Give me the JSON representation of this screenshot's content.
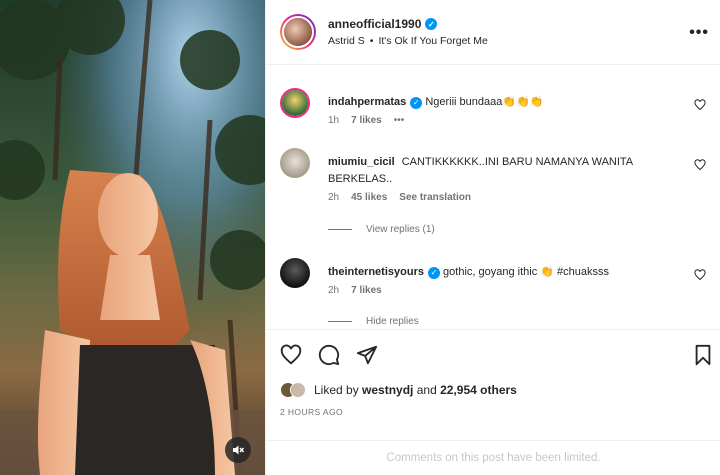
{
  "header": {
    "username": "anneofficial1990",
    "audio_artist": "Astrid S",
    "separator": "•",
    "audio_title": "It's Ok If You Forget Me"
  },
  "comments": [
    {
      "username": "indahpermatas",
      "verified": true,
      "text": "Ngeriii bundaaa👏👏👏",
      "time": "1h",
      "likes": "7 likes",
      "extra": "•••"
    },
    {
      "username": "miumiu_cicil",
      "verified": false,
      "text": "CANTIKKKKKK..INI BARU NAMANYA WANITA BERKELAS..",
      "time": "2h",
      "likes": "45 likes",
      "extra": "See translation",
      "replies": "View replies (1)"
    },
    {
      "username": "theinternetisyours",
      "verified": true,
      "text": "gothic, goyang ithic 👏 #chuaksss",
      "time": "2h",
      "likes": "7 likes",
      "replies": "Hide replies"
    }
  ],
  "post": {
    "liked_prefix": "Liked by",
    "liked_user": "westnydj",
    "liked_and": "and",
    "liked_count": "22,954 others",
    "timestamp": "2 HOURS AGO",
    "comments_limited": "Comments on this post have been limited."
  },
  "icons": {
    "like": "heart-icon",
    "comment": "comment-icon",
    "share": "share-icon",
    "save": "bookmark-icon",
    "more": "more-options-icon",
    "mute": "speaker-muted-icon",
    "verified": "verified-badge-icon"
  },
  "colors": {
    "verified": "#0095f6",
    "muted_text": "#737373",
    "limited_text": "#c7c7c7"
  }
}
